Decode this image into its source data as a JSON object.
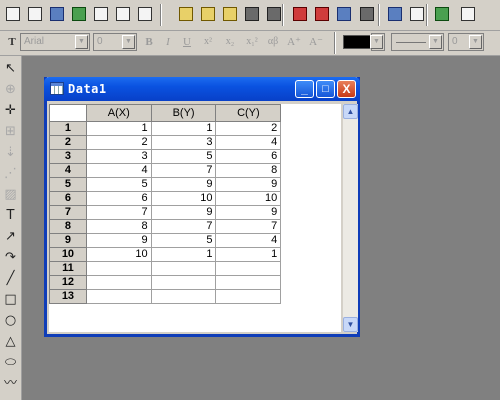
{
  "toolbar": {
    "standard_icons": [
      "new-worksheet-icon",
      "new-graph-icon",
      "new-matrix-icon",
      "new-excel-icon",
      "new-layout-icon",
      "new-function-icon",
      "new-notes-icon",
      "open-icon",
      "open-template-icon",
      "open-excel-icon",
      "save-icon",
      "save-template-icon",
      "import-ascii-icon",
      "import-multiple-icon",
      "import-excel-icon",
      "print-icon",
      "refresh-icon",
      "duplicate-icon",
      "project-explorer-icon",
      "results-log-icon"
    ]
  },
  "format_bar": {
    "font_name": "Arial",
    "font_size": "0",
    "bold": "B",
    "italic": "I",
    "underline": "U",
    "superscript": "x²",
    "subscript": "x₂",
    "supersub": "x₁²",
    "greek": "αβ",
    "increase_font": "A⁺",
    "decrease_font": "A⁻",
    "line_width": "0",
    "color_fill": "#000000"
  },
  "palette": {
    "tools": [
      "pointer-icon",
      "zoom-icon",
      "data-reader-icon",
      "screen-reader-icon",
      "data-selector-icon",
      "draw-data-icon",
      "mask-icon",
      "text-icon",
      "arrow-icon",
      "curved-arrow-icon",
      "line-icon",
      "rectangle-icon",
      "ellipse-icon",
      "polygon-icon",
      "region-icon",
      "freehand-icon"
    ]
  },
  "window": {
    "title": "Data1",
    "minimize": "_",
    "maximize": "□",
    "close": "X",
    "columns": [
      "A(X)",
      "B(Y)",
      "C(Y)"
    ],
    "rows": [
      {
        "index": "1",
        "cells": [
          "1",
          "1",
          "2"
        ]
      },
      {
        "index": "2",
        "cells": [
          "2",
          "3",
          "4"
        ]
      },
      {
        "index": "3",
        "cells": [
          "3",
          "5",
          "6"
        ]
      },
      {
        "index": "4",
        "cells": [
          "4",
          "7",
          "8"
        ]
      },
      {
        "index": "5",
        "cells": [
          "5",
          "9",
          "9"
        ]
      },
      {
        "index": "6",
        "cells": [
          "6",
          "10",
          "10"
        ]
      },
      {
        "index": "7",
        "cells": [
          "7",
          "9",
          "9"
        ]
      },
      {
        "index": "8",
        "cells": [
          "8",
          "7",
          "7"
        ]
      },
      {
        "index": "9",
        "cells": [
          "9",
          "5",
          "4"
        ]
      },
      {
        "index": "10",
        "cells": [
          "10",
          "1",
          "1"
        ]
      },
      {
        "index": "11",
        "cells": [
          "",
          "",
          ""
        ]
      },
      {
        "index": "12",
        "cells": [
          "",
          "",
          ""
        ]
      },
      {
        "index": "13",
        "cells": [
          "",
          "",
          ""
        ]
      }
    ],
    "scroll_up": "▲",
    "scroll_down": "▼"
  }
}
